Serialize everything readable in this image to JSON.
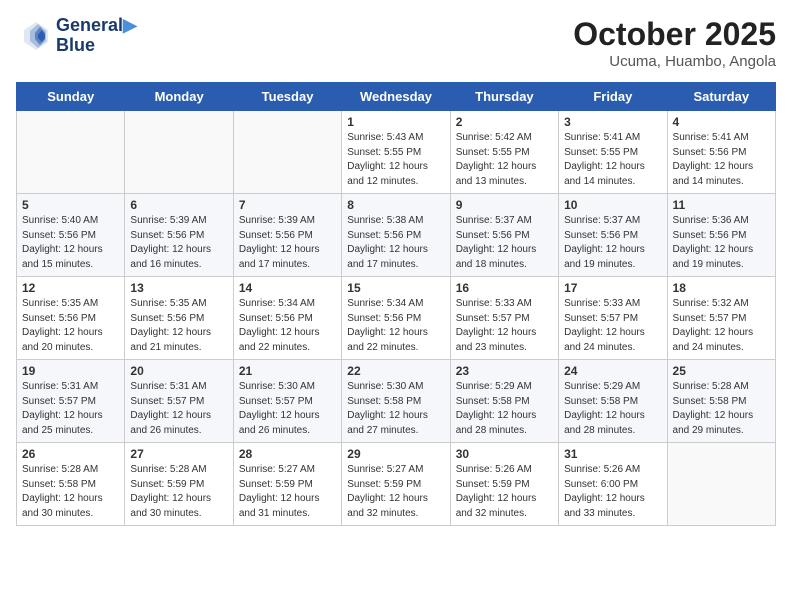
{
  "header": {
    "logo_line1": "General",
    "logo_line2": "Blue",
    "month": "October 2025",
    "location": "Ucuma, Huambo, Angola"
  },
  "weekdays": [
    "Sunday",
    "Monday",
    "Tuesday",
    "Wednesday",
    "Thursday",
    "Friday",
    "Saturday"
  ],
  "weeks": [
    [
      {
        "day": "",
        "info": ""
      },
      {
        "day": "",
        "info": ""
      },
      {
        "day": "",
        "info": ""
      },
      {
        "day": "1",
        "info": "Sunrise: 5:43 AM\nSunset: 5:55 PM\nDaylight: 12 hours\nand 12 minutes."
      },
      {
        "day": "2",
        "info": "Sunrise: 5:42 AM\nSunset: 5:55 PM\nDaylight: 12 hours\nand 13 minutes."
      },
      {
        "day": "3",
        "info": "Sunrise: 5:41 AM\nSunset: 5:55 PM\nDaylight: 12 hours\nand 14 minutes."
      },
      {
        "day": "4",
        "info": "Sunrise: 5:41 AM\nSunset: 5:56 PM\nDaylight: 12 hours\nand 14 minutes."
      }
    ],
    [
      {
        "day": "5",
        "info": "Sunrise: 5:40 AM\nSunset: 5:56 PM\nDaylight: 12 hours\nand 15 minutes."
      },
      {
        "day": "6",
        "info": "Sunrise: 5:39 AM\nSunset: 5:56 PM\nDaylight: 12 hours\nand 16 minutes."
      },
      {
        "day": "7",
        "info": "Sunrise: 5:39 AM\nSunset: 5:56 PM\nDaylight: 12 hours\nand 17 minutes."
      },
      {
        "day": "8",
        "info": "Sunrise: 5:38 AM\nSunset: 5:56 PM\nDaylight: 12 hours\nand 17 minutes."
      },
      {
        "day": "9",
        "info": "Sunrise: 5:37 AM\nSunset: 5:56 PM\nDaylight: 12 hours\nand 18 minutes."
      },
      {
        "day": "10",
        "info": "Sunrise: 5:37 AM\nSunset: 5:56 PM\nDaylight: 12 hours\nand 19 minutes."
      },
      {
        "day": "11",
        "info": "Sunrise: 5:36 AM\nSunset: 5:56 PM\nDaylight: 12 hours\nand 19 minutes."
      }
    ],
    [
      {
        "day": "12",
        "info": "Sunrise: 5:35 AM\nSunset: 5:56 PM\nDaylight: 12 hours\nand 20 minutes."
      },
      {
        "day": "13",
        "info": "Sunrise: 5:35 AM\nSunset: 5:56 PM\nDaylight: 12 hours\nand 21 minutes."
      },
      {
        "day": "14",
        "info": "Sunrise: 5:34 AM\nSunset: 5:56 PM\nDaylight: 12 hours\nand 22 minutes."
      },
      {
        "day": "15",
        "info": "Sunrise: 5:34 AM\nSunset: 5:56 PM\nDaylight: 12 hours\nand 22 minutes."
      },
      {
        "day": "16",
        "info": "Sunrise: 5:33 AM\nSunset: 5:57 PM\nDaylight: 12 hours\nand 23 minutes."
      },
      {
        "day": "17",
        "info": "Sunrise: 5:33 AM\nSunset: 5:57 PM\nDaylight: 12 hours\nand 24 minutes."
      },
      {
        "day": "18",
        "info": "Sunrise: 5:32 AM\nSunset: 5:57 PM\nDaylight: 12 hours\nand 24 minutes."
      }
    ],
    [
      {
        "day": "19",
        "info": "Sunrise: 5:31 AM\nSunset: 5:57 PM\nDaylight: 12 hours\nand 25 minutes."
      },
      {
        "day": "20",
        "info": "Sunrise: 5:31 AM\nSunset: 5:57 PM\nDaylight: 12 hours\nand 26 minutes."
      },
      {
        "day": "21",
        "info": "Sunrise: 5:30 AM\nSunset: 5:57 PM\nDaylight: 12 hours\nand 26 minutes."
      },
      {
        "day": "22",
        "info": "Sunrise: 5:30 AM\nSunset: 5:58 PM\nDaylight: 12 hours\nand 27 minutes."
      },
      {
        "day": "23",
        "info": "Sunrise: 5:29 AM\nSunset: 5:58 PM\nDaylight: 12 hours\nand 28 minutes."
      },
      {
        "day": "24",
        "info": "Sunrise: 5:29 AM\nSunset: 5:58 PM\nDaylight: 12 hours\nand 28 minutes."
      },
      {
        "day": "25",
        "info": "Sunrise: 5:28 AM\nSunset: 5:58 PM\nDaylight: 12 hours\nand 29 minutes."
      }
    ],
    [
      {
        "day": "26",
        "info": "Sunrise: 5:28 AM\nSunset: 5:58 PM\nDaylight: 12 hours\nand 30 minutes."
      },
      {
        "day": "27",
        "info": "Sunrise: 5:28 AM\nSunset: 5:59 PM\nDaylight: 12 hours\nand 30 minutes."
      },
      {
        "day": "28",
        "info": "Sunrise: 5:27 AM\nSunset: 5:59 PM\nDaylight: 12 hours\nand 31 minutes."
      },
      {
        "day": "29",
        "info": "Sunrise: 5:27 AM\nSunset: 5:59 PM\nDaylight: 12 hours\nand 32 minutes."
      },
      {
        "day": "30",
        "info": "Sunrise: 5:26 AM\nSunset: 5:59 PM\nDaylight: 12 hours\nand 32 minutes."
      },
      {
        "day": "31",
        "info": "Sunrise: 5:26 AM\nSunset: 6:00 PM\nDaylight: 12 hours\nand 33 minutes."
      },
      {
        "day": "",
        "info": ""
      }
    ]
  ]
}
